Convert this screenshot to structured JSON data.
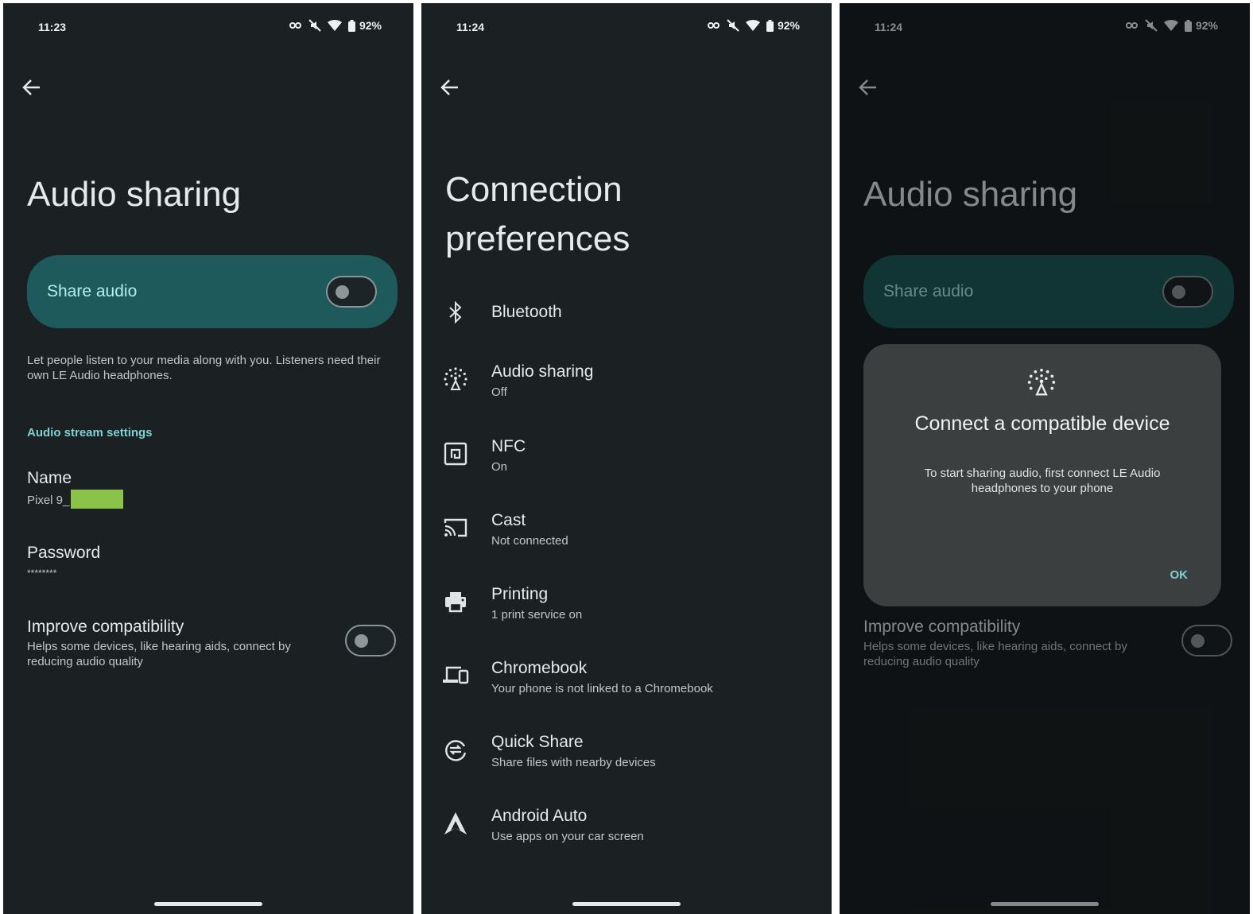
{
  "screens": [
    {
      "status": {
        "time": "11:23",
        "battery": "92%"
      },
      "title": "Audio sharing",
      "share_audio_label": "Share audio",
      "description": "Let people listen to your media along with you. Listeners need their own LE Audio headphones.",
      "section_header": "Audio stream settings",
      "name_label": "Name",
      "name_value": "Pixel 9_",
      "password_label": "Password",
      "password_value": "********",
      "improve_label": "Improve compatibility",
      "improve_desc": "Helps some devices, like hearing aids, connect by reducing audio quality"
    },
    {
      "status": {
        "time": "11:24",
        "battery": "92%"
      },
      "title_line1": "Connection",
      "title_line2": "preferences",
      "items": [
        {
          "title": "Bluetooth",
          "subtitle": "",
          "icon": "bluetooth-icon"
        },
        {
          "title": "Audio sharing",
          "subtitle": "Off",
          "icon": "audio-sharing-icon"
        },
        {
          "title": "NFC",
          "subtitle": "On",
          "icon": "nfc-icon"
        },
        {
          "title": "Cast",
          "subtitle": "Not connected",
          "icon": "cast-icon"
        },
        {
          "title": "Printing",
          "subtitle": "1 print service on",
          "icon": "printer-icon"
        },
        {
          "title": "Chromebook",
          "subtitle": "Your phone is not linked to a Chromebook",
          "icon": "devices-icon"
        },
        {
          "title": "Quick Share",
          "subtitle": "Share files with nearby devices",
          "icon": "quick-share-icon"
        },
        {
          "title": "Android Auto",
          "subtitle": "Use apps on your car screen",
          "icon": "android-auto-icon"
        }
      ]
    },
    {
      "status": {
        "time": "11:24",
        "battery": "92%"
      },
      "title": "Audio sharing",
      "share_audio_label": "Share audio",
      "improve_label": "Improve compatibility",
      "improve_desc": "Helps some devices, like hearing aids, connect by reducing audio quality",
      "dialog": {
        "title": "Connect a compatible device",
        "body": "To start sharing audio, first connect LE Audio headphones to your phone",
        "ok": "OK"
      }
    }
  ],
  "colors": {
    "background": "#1b2023",
    "accent": "#7fd1cf",
    "card": "#1e5a5c",
    "dialog": "#3b3f40",
    "redaction": "#8bc34a"
  }
}
